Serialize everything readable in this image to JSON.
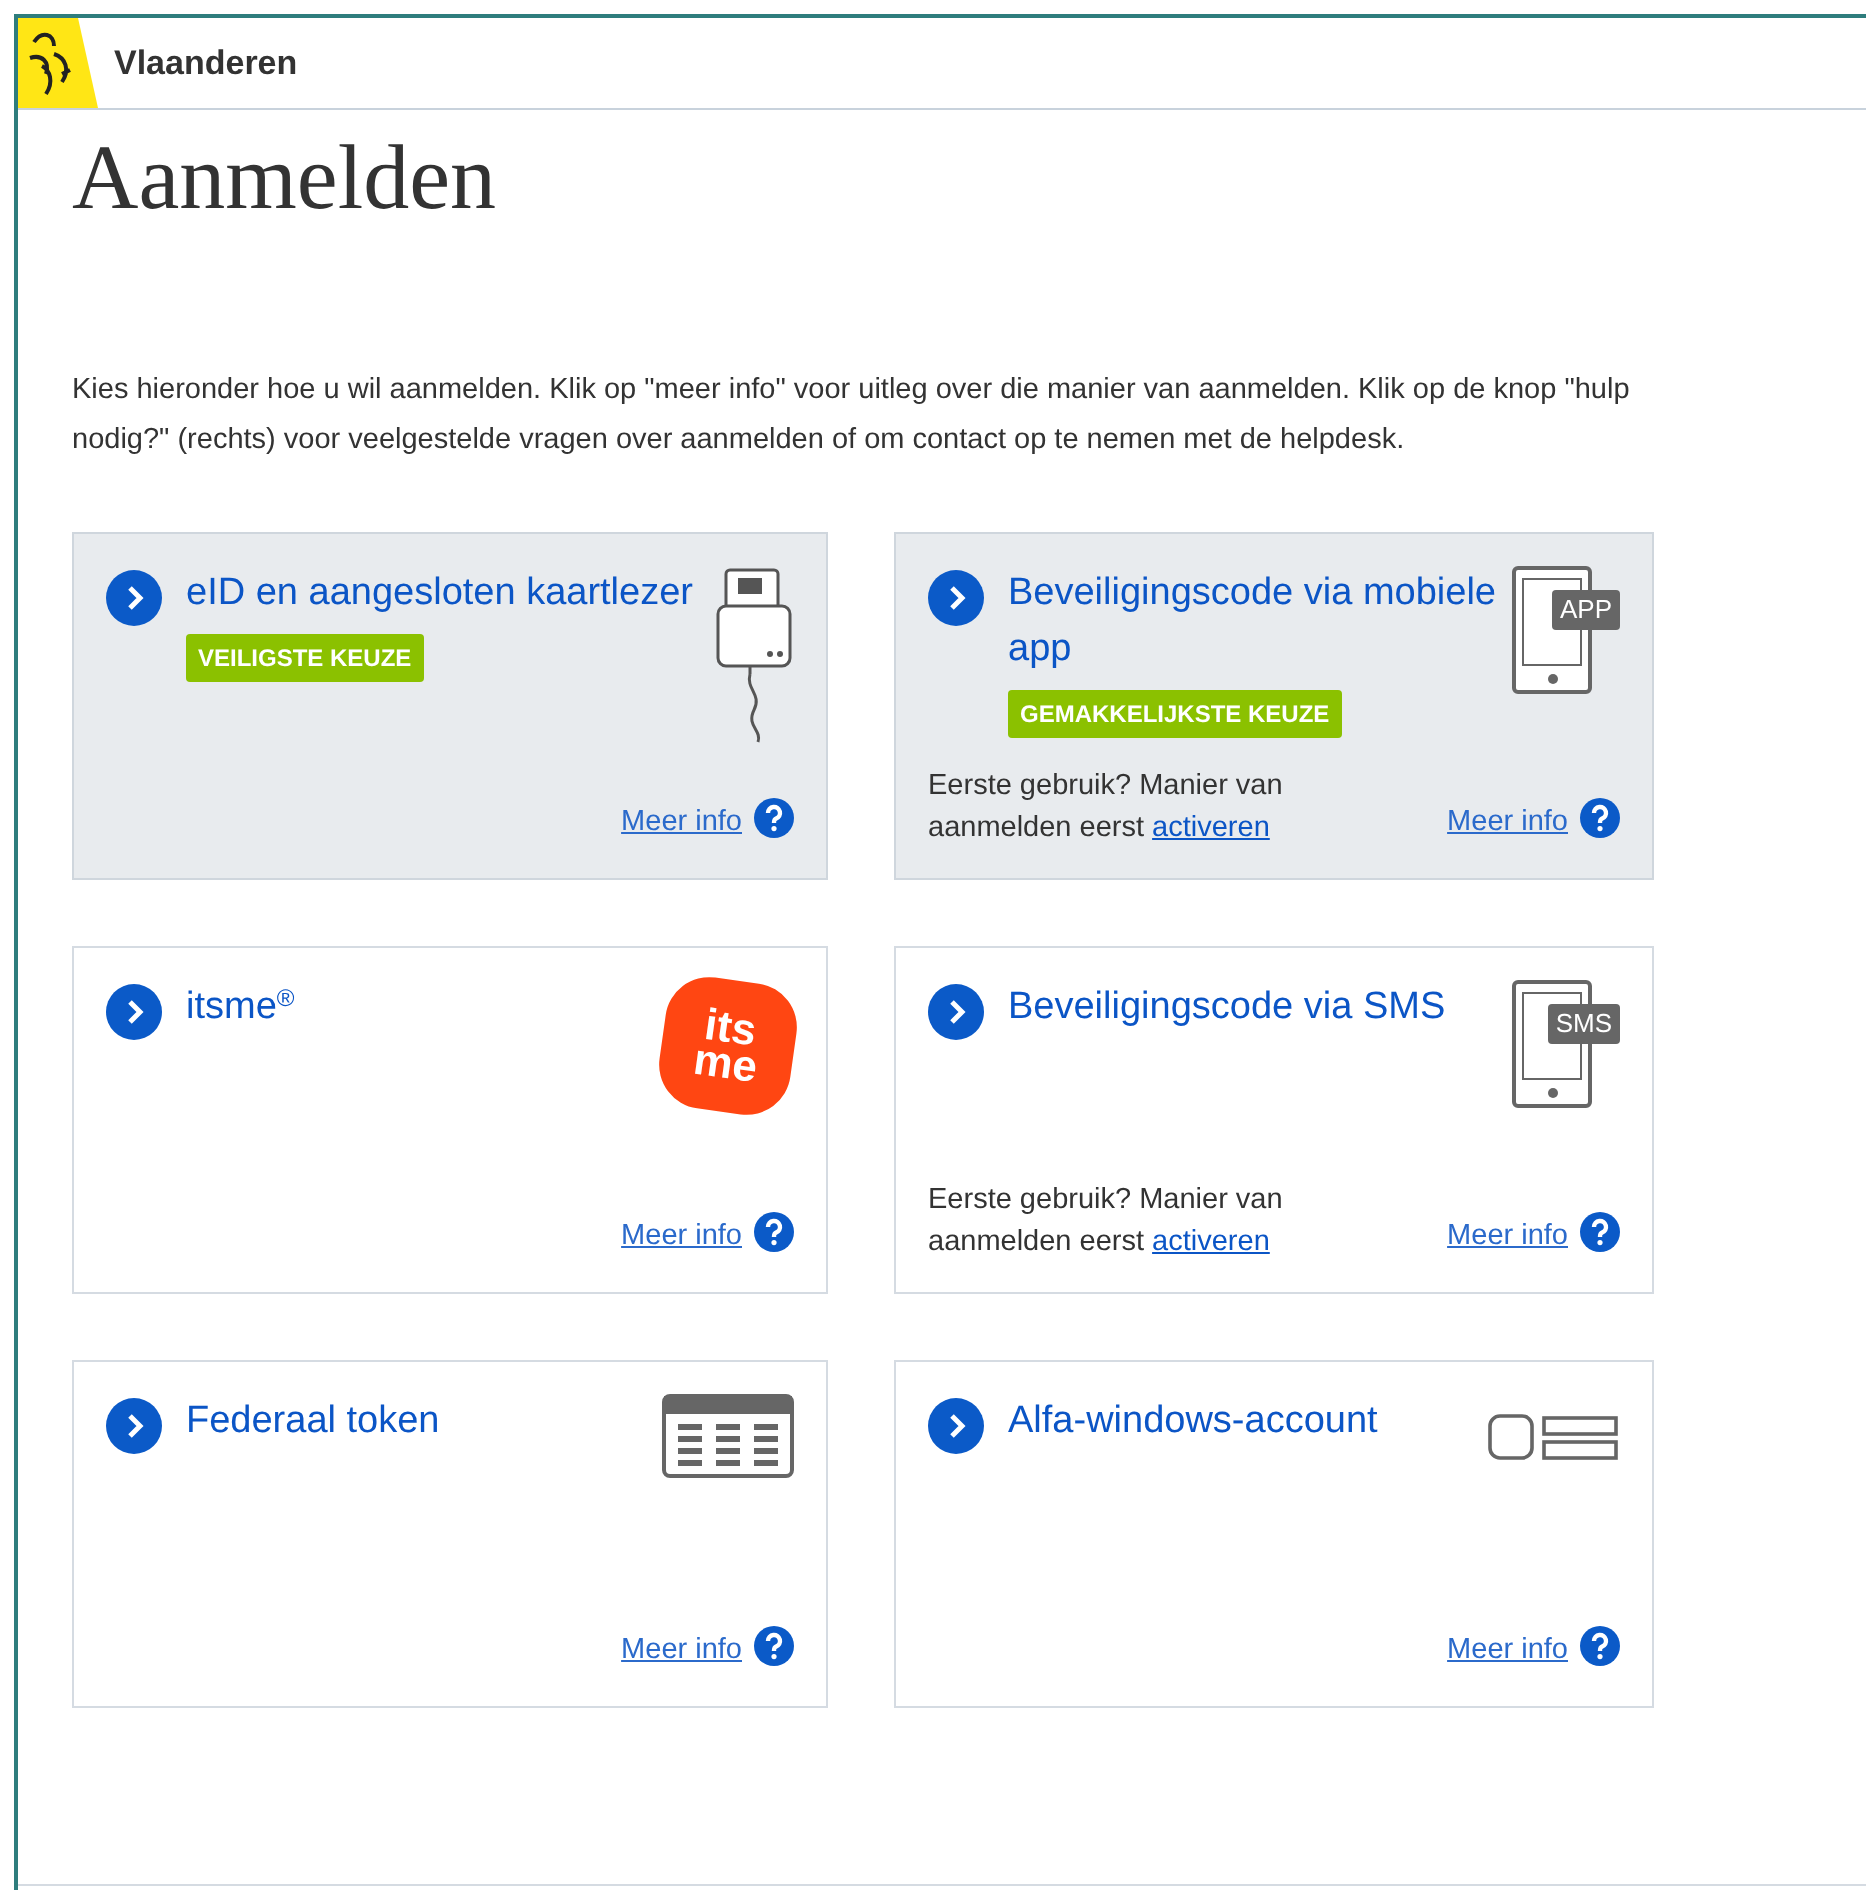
{
  "header": {
    "brand": "Vlaanderen"
  },
  "title": "Aanmelden",
  "intro": "Kies hieronder hoe u wil aanmelden. Klik op \"meer info\" voor uitleg over die manier van aanmelden. Klik op de knop \"hulp nodig?\" (rechts) voor veelgestelde vragen over aanmelden of om contact op te nemen met de helpdesk.",
  "methods": [
    {
      "title": "eID en aangesloten kaartlezer",
      "highlighted": true,
      "badge": "VEILIGSTE KEUZE",
      "icon": {
        "kind": "card_reader"
      },
      "more_info": "Meer info"
    },
    {
      "title": "Beveiligingscode via mobiele app",
      "highlighted": true,
      "badge": "GEMAKKELIJKSTE KEUZE",
      "icon": {
        "kind": "phone",
        "label": "APP"
      },
      "note": "Eerste gebruik? Manier van aanmelden eerst",
      "note_link": "activeren",
      "more_info": "Meer info"
    },
    {
      "title": "itsme$^{®}$",
      "highlighted": false,
      "icon": {
        "kind": "logo",
        "lines": [
          "its",
          "me"
        ]
      },
      "more_info": "Meer info"
    },
    {
      "title": "Beveiligingscode via SMS",
      "highlighted": false,
      "icon": {
        "kind": "phone",
        "label": "SMS"
      },
      "note": "Eerste gebruik? Manier van aanmelden eerst",
      "note_link": "activeren",
      "more_info": "Meer info"
    },
    {
      "title": "Federaal token",
      "highlighted": false,
      "icon": {
        "kind": "token"
      },
      "more_info": "Meer info"
    },
    {
      "title": "Alfa-windows-account",
      "highlighted": false,
      "icon": {
        "kind": "account"
      },
      "more_info": "Meer info"
    }
  ]
}
